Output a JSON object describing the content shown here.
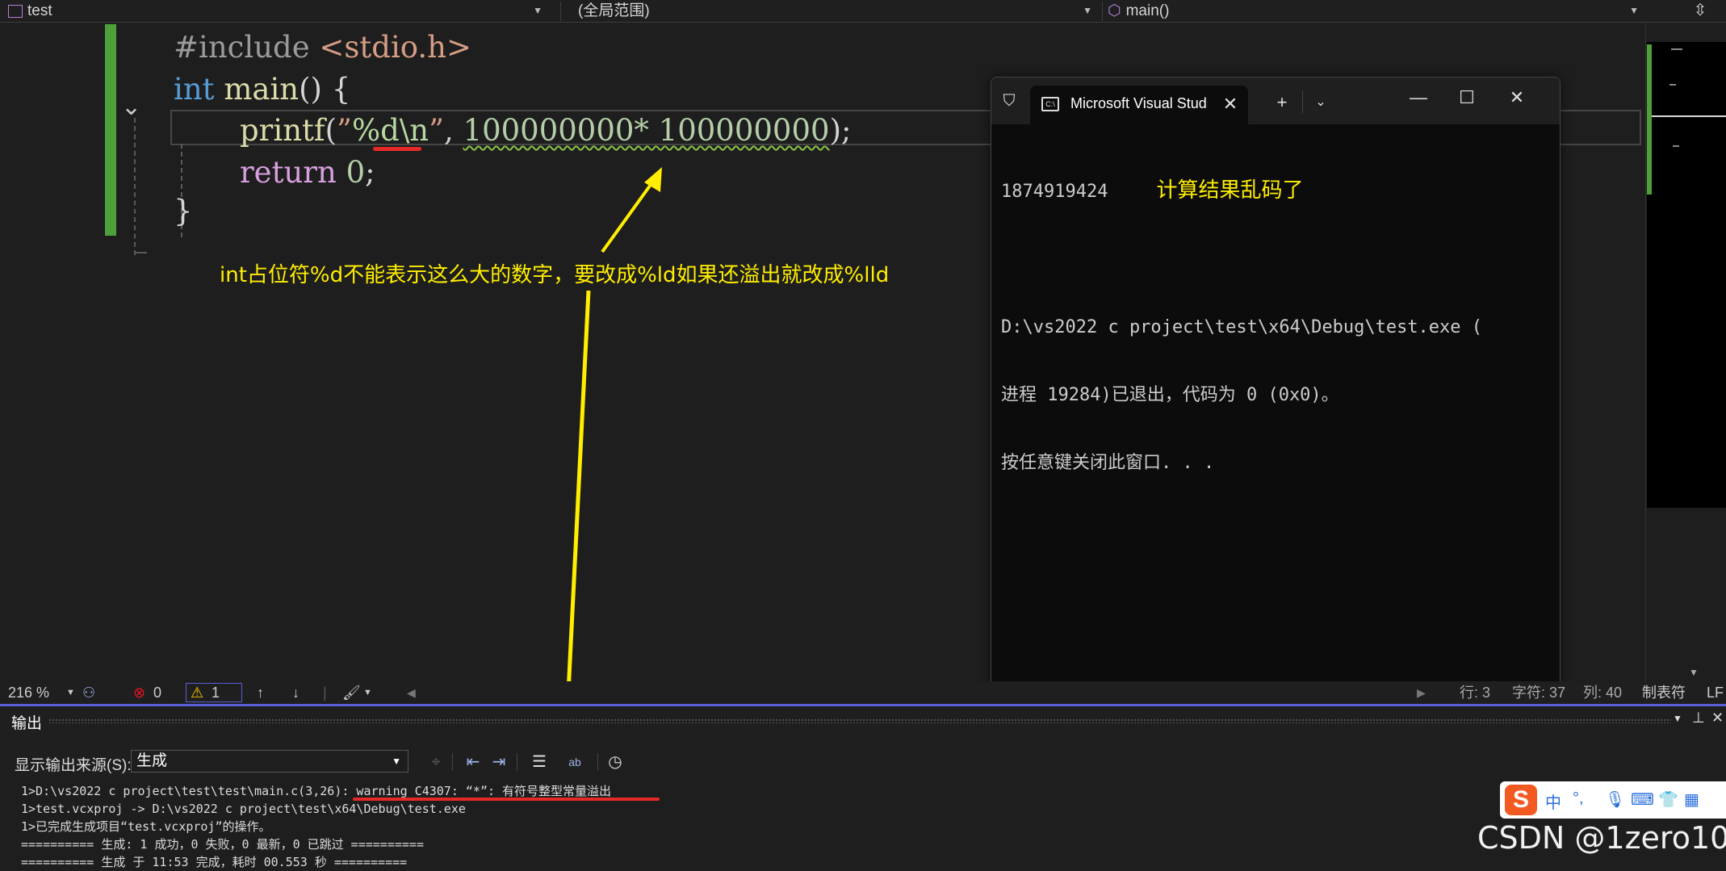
{
  "navbar": {
    "project": "test",
    "scope": "(全局范围)",
    "member": "main()"
  },
  "editor": {
    "line1": {
      "directive": "#include",
      "header": "<stdio.h>"
    },
    "line2": {
      "type": "int",
      "name": "main",
      "rest": "() {"
    },
    "line3": {
      "func": "printf",
      "open": "(",
      "q1": "”",
      "fmt": "%d",
      "esc": "\\n",
      "q2": "”",
      "comma": ", ",
      "expr": "100000000* 100000000",
      "close": ");"
    },
    "line4": {
      "kw": "return",
      "num": "0",
      "semi": ";"
    },
    "line5": {
      "brace": "}"
    }
  },
  "annotations": {
    "console_note": "计算结果乱码了",
    "code_note": "int占位符%d不能表示这么大的数字，要改成%ld如果还溢出就改成%lld"
  },
  "console": {
    "tab_title": "Microsoft Visual Studio Debug Console",
    "result": "1874919424",
    "exit_line1": "D:\\vs2022 c project\\test\\x64\\Debug\\test.exe (",
    "exit_line2": "进程 19284)已退出，代码为 0 (0x0)。",
    "exit_line3": "按任意键关闭此窗口. . ."
  },
  "status": {
    "zoom": "216 %",
    "errors": "0",
    "warnings": "1",
    "line": "行: 3",
    "char": "字符: 37",
    "col": "列: 40",
    "tabs": "制表符",
    "eol": "LF"
  },
  "output": {
    "title": "输出",
    "source_label": "显示输出来源(S):",
    "source_value": "生成",
    "lines": [
      "1>D:\\vs2022 c project\\test\\test\\main.c(3,26): warning C4307: “*”: 有符号整型常量溢出",
      "1>test.vcxproj -> D:\\vs2022 c project\\test\\x64\\Debug\\test.exe",
      "1>已完成生成项目“test.vcxproj”的操作。",
      "========== 生成: 1 成功，0 失败，0 最新，0 已跳过 ==========",
      "========== 生成 于 11:53 完成，耗时 00.553 秒 =========="
    ]
  },
  "ime": {
    "lang": "中",
    "punct": "°,"
  },
  "watermark": "CSDN @1zero10",
  "colors": {
    "annotation": "#ffee00",
    "underline": "#e62828",
    "accent": "#5a5dd6",
    "change_bar": "#4ea13a"
  }
}
